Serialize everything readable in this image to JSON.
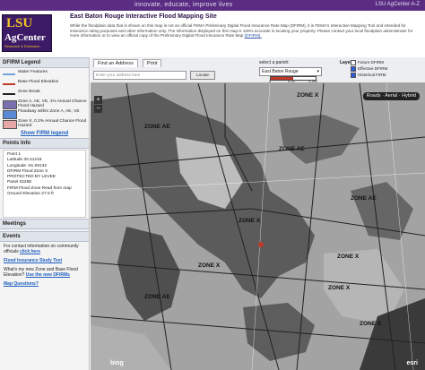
{
  "topbar": {
    "slogan": "innovate, educate, improve lives",
    "az": "LSU AgCenter A-Z"
  },
  "logo": {
    "lsu": "LSU",
    "ag": "AgCenter",
    "sub": "Research & Extension"
  },
  "header": {
    "title": "East Baton Rouge Interactive Flood Mapping Site",
    "desc": "While the floodplain data that is shown on this map is not an official FEMA Preliminary Digital Flood Insurance Rate Map (DFIRM), it is FEMA's Interactive Mapping Tool and intended for insurance rating purposes and other information only. The information displayed on this map is 100% accurate in locating your property. Please contact your local floodplain administrator for more information or to view an official copy of the Preliminary Digital Flood Insurance Rate Map",
    "link": "(DFIRM)."
  },
  "sidebar": {
    "legend_title": "DFIRM Legend",
    "legend": [
      {
        "label": "Water Features",
        "color": "#6fa3d9"
      },
      {
        "label": "Base Flood Elevation",
        "color": "#c0392b"
      },
      {
        "label": "Zone Break",
        "color": "#222222"
      },
      {
        "label": "Zone A, AE, VE, 1% Annual Chance Flood Hazard",
        "color": "#7b6fb0"
      },
      {
        "label": "Floodway within Zone A, AE, VE",
        "color": "#5a8ad6"
      },
      {
        "label": "Zone X, 0.2% Annual Chance Flood Hazard",
        "color": "#e8a7a7"
      }
    ],
    "show_firm": "Show FIRM legend",
    "points_title": "Points Info",
    "points": [
      "Point 1",
      "Latitude 30.41218",
      "Longitude -91.09132",
      "DFIRM Flood Zone X",
      "PROTECTED BY LEVEE",
      "Panel 0225E",
      "FIRM Flood Zone Read from map",
      "Ground Elevation 27.5 ft"
    ],
    "meetings_title": "Meetings",
    "events_title": "Events",
    "events": [
      {
        "text": "For contact information on community officials",
        "link": "click here"
      },
      {
        "text": "",
        "link": "Flood Insurance Study Text"
      },
      {
        "text": "What's my new Zone and Base Flood Elevation?",
        "link": "Use the new DFIRMs"
      },
      {
        "text": "",
        "link": "Map Questions?"
      }
    ]
  },
  "toolbar": {
    "tab_find": "Find an Address",
    "tab_print": "Print",
    "addr_placeholder": "Enter your address here",
    "locate": "Locate",
    "parish_label": "select a parish:",
    "parish_value": "East Baton Rouge",
    "scale_labels": [
      "0",
      "0.15",
      "0.3mi"
    ],
    "layers_label": "Layers:",
    "layers": [
      {
        "label": "Future DFIRM",
        "checked": false
      },
      {
        "label": "Effective DFIRM",
        "checked": true
      },
      {
        "label": "Historical FIRM",
        "checked": true
      }
    ]
  },
  "map": {
    "modes": [
      "Roads",
      "Aerial",
      "Hybrid"
    ],
    "zoom_in": "+",
    "zoom_out": "−",
    "zones": [
      "ZONE AE",
      "ZONE X",
      "ZONE AE",
      "ZONE X",
      "ZONE AE",
      "ZONE X",
      "ZONE X",
      "ZONE X",
      "ZONE AE",
      "ZONE X"
    ],
    "bing": "bing",
    "esri": "esri"
  }
}
